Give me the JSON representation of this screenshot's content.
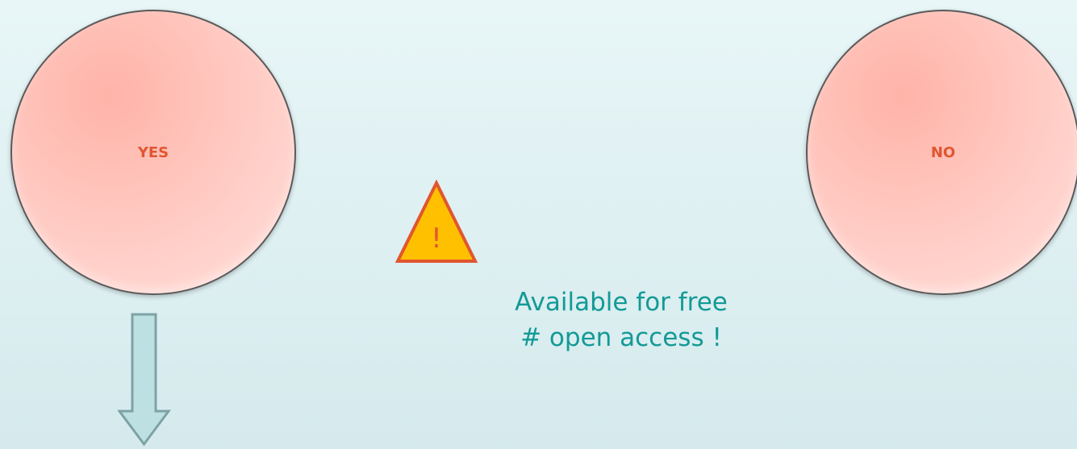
{
  "yes_label": "YES",
  "no_label": "NO",
  "warning_symbol": "!",
  "note": {
    "line1": "Available for free",
    "line2": "# open access !"
  },
  "colors": {
    "background": "#e3f3f5",
    "circle_fill": "#ffc8c0",
    "circle_text": "#e0562f",
    "arrow_fill": "#bde0e3",
    "arrow_stroke": "#7da2a6",
    "warning_fill": "#ffc000",
    "warning_stroke": "#e0562f",
    "note_text": "#139a96"
  },
  "icons": [
    "down-arrow-icon",
    "warning-triangle-icon"
  ]
}
